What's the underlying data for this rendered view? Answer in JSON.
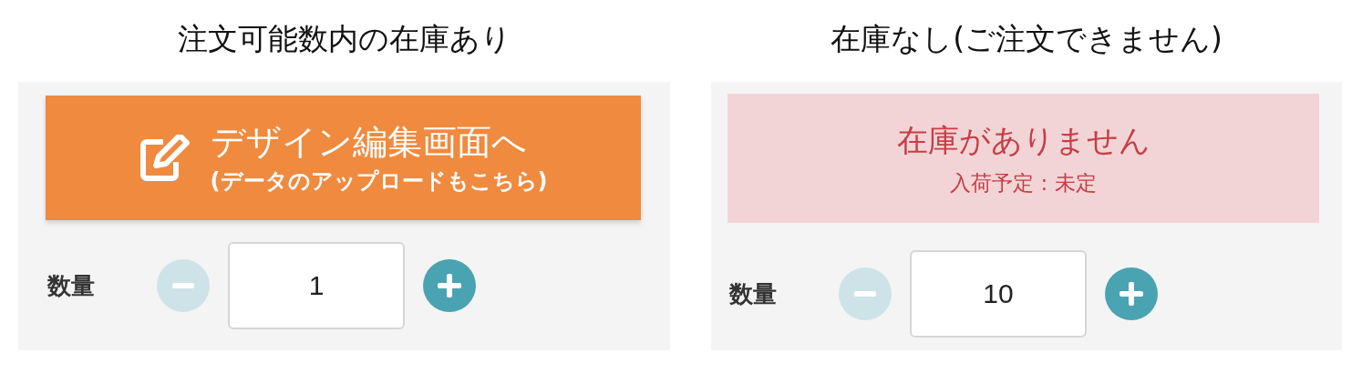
{
  "panels": [
    {
      "caption": "注文可能数内の在庫あり",
      "notice": {
        "kind": "button",
        "title": "デザイン編集画面へ",
        "subtitle": "(データのアップロードもこちら)"
      },
      "quantity": {
        "label": "数量",
        "value": "1",
        "minus": {
          "disabled": true
        },
        "plus": {
          "disabled": false
        }
      }
    },
    {
      "caption": "在庫なし(ご注文できません)",
      "notice": {
        "kind": "alert",
        "title": "在庫がありません",
        "subtitle": "入荷予定 : 未定"
      },
      "quantity": {
        "label": "数量",
        "value": "10",
        "minus": {
          "disabled": true
        },
        "plus": {
          "disabled": false
        }
      }
    }
  ]
}
